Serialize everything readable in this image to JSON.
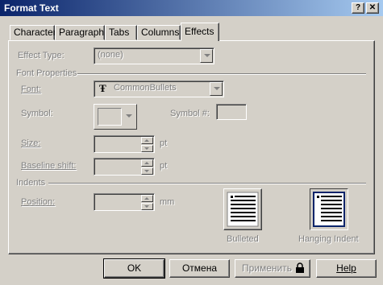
{
  "window": {
    "title": "Format Text",
    "help_glyph": "?",
    "close_glyph": "✕"
  },
  "tabs": [
    {
      "label": "Character"
    },
    {
      "label": "Paragraph"
    },
    {
      "label": "Tabs"
    },
    {
      "label": "Columns"
    },
    {
      "label": "Effects",
      "active": true
    }
  ],
  "effects": {
    "effect_type_label": "Effect Type:",
    "effect_type_value": "(none)",
    "font_properties_label": "Font Properties",
    "font_label": "Font:",
    "font_value": "CommonBullets",
    "font_icon_glyph": "Ŧ",
    "symbol_label": "Symbol:",
    "symbol_number_label": "Symbol #:",
    "size_label": "Size:",
    "size_unit": "pt",
    "baseline_shift_label": "Baseline shift:",
    "baseline_shift_unit": "pt",
    "indents_label": "Indents",
    "position_label": "Position:",
    "position_unit": "mm",
    "bulleted_label": "Bulleted",
    "hanging_indent_label": "Hanging Indent"
  },
  "buttons": {
    "ok": "OK",
    "cancel": "Отмена",
    "apply": "Применить",
    "help": "Help"
  }
}
